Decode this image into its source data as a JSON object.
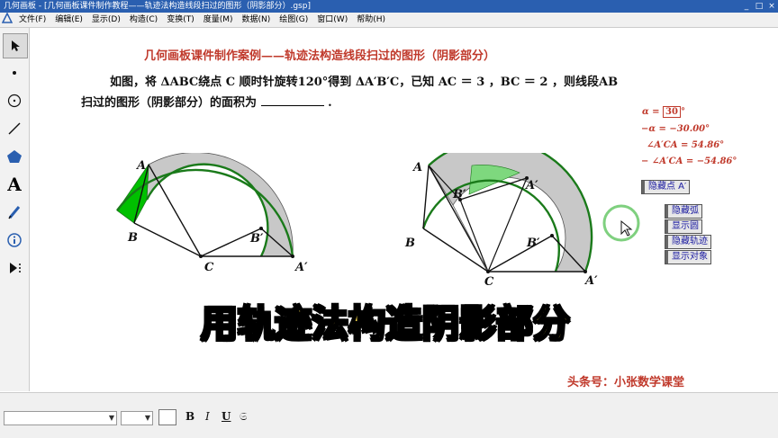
{
  "window": {
    "title": "几何画板 - [几何画板课件制作教程——轨迹法构造线段扫过的图形（阴影部分）.gsp]",
    "controls": [
      "_",
      "□",
      "×"
    ]
  },
  "menu": [
    "文件(F)",
    "编辑(E)",
    "显示(D)",
    "构造(C)",
    "变换(T)",
    "度量(M)",
    "数据(N)",
    "绘图(G)",
    "窗口(W)",
    "帮助(H)"
  ],
  "toolbox": {
    "tools": [
      "arrow-tool-icon",
      "point-tool-icon",
      "compass-tool-icon",
      "straightedge-tool-icon",
      "polygon-tool-icon",
      "text-tool-icon",
      "marker-tool-icon",
      "information-tool-icon",
      "custom-tool-icon"
    ],
    "label_glyph": "A"
  },
  "sketch": {
    "headline": "几何画板课件制作案例——轨迹法构造线段扫过的图形（阴影部分）",
    "problem_line1": "如图，将 ΔABC绕点 C 顺时针旋转120°得到 ΔA′B′C，已知 AC ＝ 3 ，BC ＝ 2 ，则线段AB",
    "problem_line2": "扫过的图形（阴影部分）的面积为",
    "problem_end": ".",
    "measurements": {
      "alpha_label": "α =",
      "alpha_value": "30",
      "alpha_unit": "°",
      "neg_alpha": "−α = −30.00°",
      "angle1": "∠A′CA = 54.86°",
      "angle2": "− ∠A′CA = −54.86°"
    },
    "buttons": {
      "hide_point": "隐藏点 A′",
      "hide_arc": "隐藏弧",
      "show_circle": "显示圆",
      "hide_locus": "隐藏轨迹",
      "show_object": "显示对象"
    },
    "labels_left": {
      "A": "A",
      "B": "B",
      "C": "C",
      "B2": "B′",
      "A2": "A′"
    },
    "labels_right": {
      "A": "A",
      "B": "B",
      "C": "C",
      "B2": "B′",
      "B3": "B′",
      "A2": "A′",
      "A3": "A′"
    },
    "banner": "用轨迹法构造阴影部分",
    "credit": "头条号：小张数学课堂",
    "colors": {
      "arc": "#1a7a1a",
      "fill_gray": "#c8c8c8",
      "fill_green": "#00c000",
      "accent_red": "#c0392b"
    }
  },
  "status_bar": {
    "font_value": "",
    "size_value": "",
    "format_buttons": {
      "bold": "B",
      "italic": "I",
      "underline": "U",
      "symbol": "𝔖"
    }
  }
}
